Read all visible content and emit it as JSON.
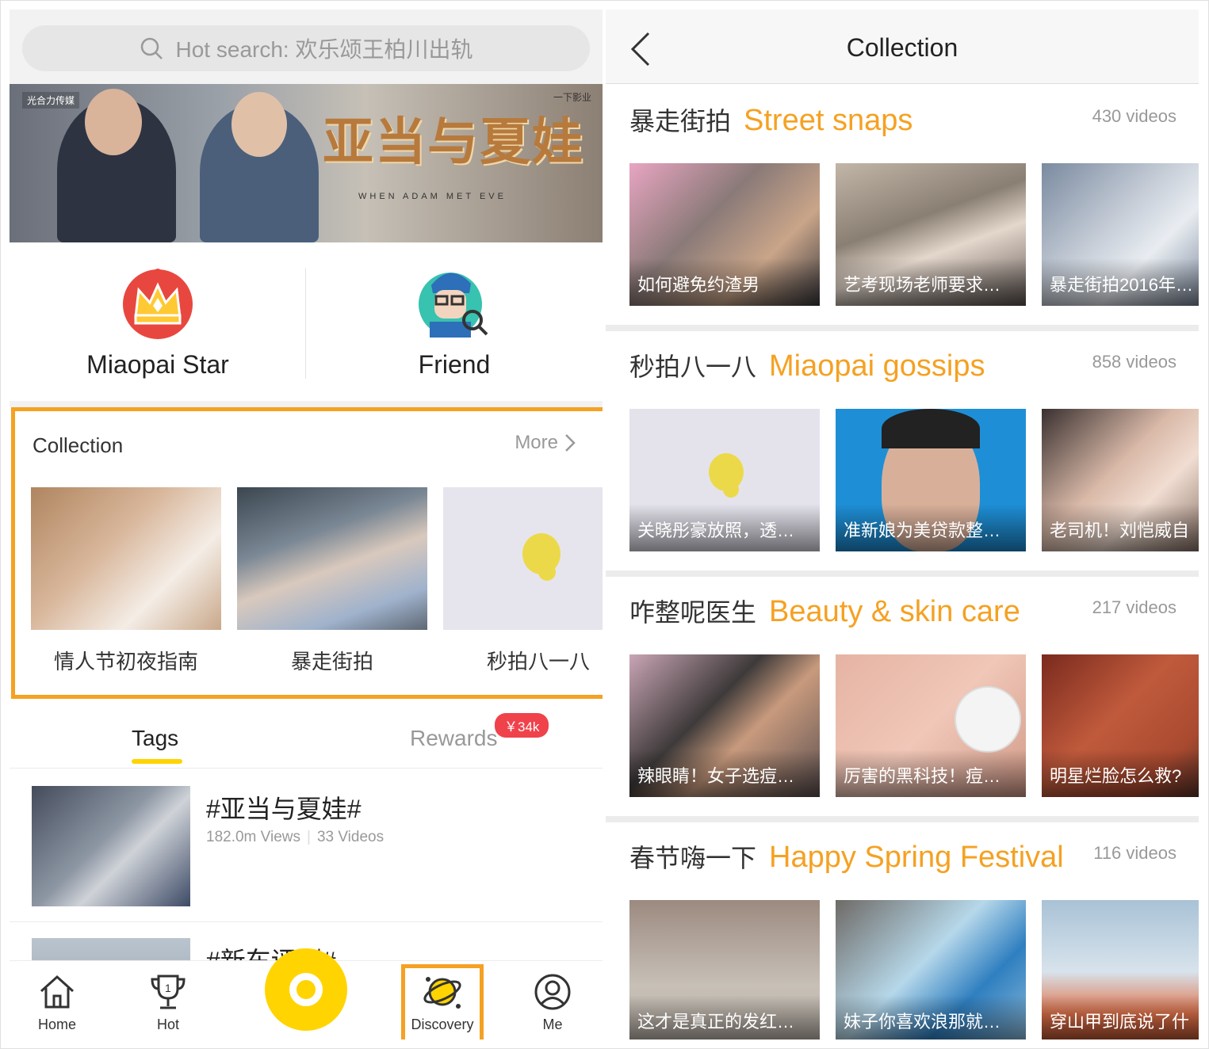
{
  "search": {
    "placeholder": "Hot search: 欢乐颂王柏川出轨"
  },
  "banner": {
    "title": "亚当与夏娃",
    "subtitle": "WHEN ADAM MET EVE",
    "logo_left": "光合力传媒",
    "logo_right": "一下影业"
  },
  "quick": {
    "star_label": "Miaopai Star",
    "friend_label": "Friend"
  },
  "collection": {
    "title": "Collection",
    "more": "More",
    "items": [
      {
        "caption": "情人节初夜指南"
      },
      {
        "caption": "暴走街拍"
      },
      {
        "caption": "秒拍八一八"
      }
    ]
  },
  "tabs": {
    "tags": "Tags",
    "rewards": "Rewards",
    "rewards_badge": "￥34k"
  },
  "tag_list": [
    {
      "name": "#亚当与夏娃#",
      "views": "182.0m Views",
      "videos": "33 Videos"
    },
    {
      "name": "#新车评测#"
    }
  ],
  "nav": {
    "home": "Home",
    "hot": "Hot",
    "discovery": "Discovery",
    "me": "Me"
  },
  "right": {
    "title": "Collection",
    "sections": [
      {
        "cn": "暴走街拍",
        "en": "Street snaps",
        "count": "430 videos",
        "videos": [
          "如何避免约渣男",
          "艺考现场老师要求…",
          "暴走街拍2016年…"
        ]
      },
      {
        "cn": "秒拍八一八",
        "en": "Miaopai gossips",
        "count": "858 videos",
        "videos": [
          "关晓彤豪放照，透…",
          "准新娘为美贷款整…",
          "老司机！刘恺威自"
        ]
      },
      {
        "cn": "咋整呢医生",
        "en": "Beauty & skin care",
        "count": "217 videos",
        "videos": [
          "辣眼睛！女子选痘…",
          "厉害的黑科技！痘…",
          "明星烂脸怎么救?"
        ]
      },
      {
        "cn": "春节嗨一下",
        "en": "Happy Spring Festival",
        "count": "116 videos",
        "videos": [
          "这才是真正的发红…",
          "妹子你喜欢浪那就…",
          "穿山甲到底说了什"
        ]
      }
    ]
  },
  "colors": {
    "accent": "#f5a122",
    "brand_yellow": "#ffd400",
    "badge_red": "#f0424b"
  }
}
